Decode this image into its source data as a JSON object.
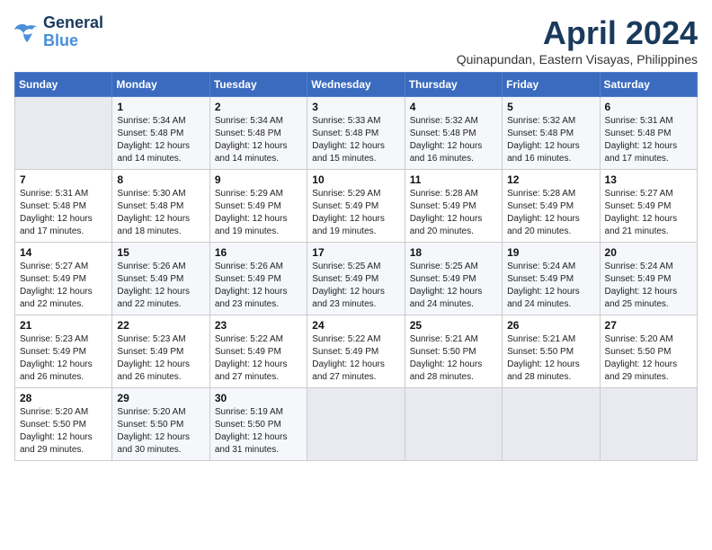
{
  "logo": {
    "line1": "General",
    "line2": "Blue"
  },
  "title": "April 2024",
  "subtitle": "Quinapundan, Eastern Visayas, Philippines",
  "weekdays": [
    "Sunday",
    "Monday",
    "Tuesday",
    "Wednesday",
    "Thursday",
    "Friday",
    "Saturday"
  ],
  "weeks": [
    [
      {
        "day": "",
        "info": ""
      },
      {
        "day": "1",
        "info": "Sunrise: 5:34 AM\nSunset: 5:48 PM\nDaylight: 12 hours\nand 14 minutes."
      },
      {
        "day": "2",
        "info": "Sunrise: 5:34 AM\nSunset: 5:48 PM\nDaylight: 12 hours\nand 14 minutes."
      },
      {
        "day": "3",
        "info": "Sunrise: 5:33 AM\nSunset: 5:48 PM\nDaylight: 12 hours\nand 15 minutes."
      },
      {
        "day": "4",
        "info": "Sunrise: 5:32 AM\nSunset: 5:48 PM\nDaylight: 12 hours\nand 16 minutes."
      },
      {
        "day": "5",
        "info": "Sunrise: 5:32 AM\nSunset: 5:48 PM\nDaylight: 12 hours\nand 16 minutes."
      },
      {
        "day": "6",
        "info": "Sunrise: 5:31 AM\nSunset: 5:48 PM\nDaylight: 12 hours\nand 17 minutes."
      }
    ],
    [
      {
        "day": "7",
        "info": "Sunrise: 5:31 AM\nSunset: 5:48 PM\nDaylight: 12 hours\nand 17 minutes."
      },
      {
        "day": "8",
        "info": "Sunrise: 5:30 AM\nSunset: 5:48 PM\nDaylight: 12 hours\nand 18 minutes."
      },
      {
        "day": "9",
        "info": "Sunrise: 5:29 AM\nSunset: 5:49 PM\nDaylight: 12 hours\nand 19 minutes."
      },
      {
        "day": "10",
        "info": "Sunrise: 5:29 AM\nSunset: 5:49 PM\nDaylight: 12 hours\nand 19 minutes."
      },
      {
        "day": "11",
        "info": "Sunrise: 5:28 AM\nSunset: 5:49 PM\nDaylight: 12 hours\nand 20 minutes."
      },
      {
        "day": "12",
        "info": "Sunrise: 5:28 AM\nSunset: 5:49 PM\nDaylight: 12 hours\nand 20 minutes."
      },
      {
        "day": "13",
        "info": "Sunrise: 5:27 AM\nSunset: 5:49 PM\nDaylight: 12 hours\nand 21 minutes."
      }
    ],
    [
      {
        "day": "14",
        "info": "Sunrise: 5:27 AM\nSunset: 5:49 PM\nDaylight: 12 hours\nand 22 minutes."
      },
      {
        "day": "15",
        "info": "Sunrise: 5:26 AM\nSunset: 5:49 PM\nDaylight: 12 hours\nand 22 minutes."
      },
      {
        "day": "16",
        "info": "Sunrise: 5:26 AM\nSunset: 5:49 PM\nDaylight: 12 hours\nand 23 minutes."
      },
      {
        "day": "17",
        "info": "Sunrise: 5:25 AM\nSunset: 5:49 PM\nDaylight: 12 hours\nand 23 minutes."
      },
      {
        "day": "18",
        "info": "Sunrise: 5:25 AM\nSunset: 5:49 PM\nDaylight: 12 hours\nand 24 minutes."
      },
      {
        "day": "19",
        "info": "Sunrise: 5:24 AM\nSunset: 5:49 PM\nDaylight: 12 hours\nand 24 minutes."
      },
      {
        "day": "20",
        "info": "Sunrise: 5:24 AM\nSunset: 5:49 PM\nDaylight: 12 hours\nand 25 minutes."
      }
    ],
    [
      {
        "day": "21",
        "info": "Sunrise: 5:23 AM\nSunset: 5:49 PM\nDaylight: 12 hours\nand 26 minutes."
      },
      {
        "day": "22",
        "info": "Sunrise: 5:23 AM\nSunset: 5:49 PM\nDaylight: 12 hours\nand 26 minutes."
      },
      {
        "day": "23",
        "info": "Sunrise: 5:22 AM\nSunset: 5:49 PM\nDaylight: 12 hours\nand 27 minutes."
      },
      {
        "day": "24",
        "info": "Sunrise: 5:22 AM\nSunset: 5:49 PM\nDaylight: 12 hours\nand 27 minutes."
      },
      {
        "day": "25",
        "info": "Sunrise: 5:21 AM\nSunset: 5:50 PM\nDaylight: 12 hours\nand 28 minutes."
      },
      {
        "day": "26",
        "info": "Sunrise: 5:21 AM\nSunset: 5:50 PM\nDaylight: 12 hours\nand 28 minutes."
      },
      {
        "day": "27",
        "info": "Sunrise: 5:20 AM\nSunset: 5:50 PM\nDaylight: 12 hours\nand 29 minutes."
      }
    ],
    [
      {
        "day": "28",
        "info": "Sunrise: 5:20 AM\nSunset: 5:50 PM\nDaylight: 12 hours\nand 29 minutes."
      },
      {
        "day": "29",
        "info": "Sunrise: 5:20 AM\nSunset: 5:50 PM\nDaylight: 12 hours\nand 30 minutes."
      },
      {
        "day": "30",
        "info": "Sunrise: 5:19 AM\nSunset: 5:50 PM\nDaylight: 12 hours\nand 31 minutes."
      },
      {
        "day": "",
        "info": ""
      },
      {
        "day": "",
        "info": ""
      },
      {
        "day": "",
        "info": ""
      },
      {
        "day": "",
        "info": ""
      }
    ]
  ]
}
